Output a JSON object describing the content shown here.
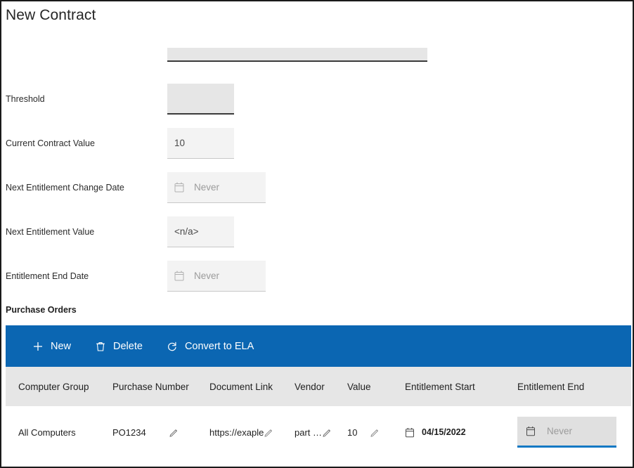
{
  "page": {
    "title": "New Contract"
  },
  "form": {
    "rows": [
      {
        "label": "",
        "value": "",
        "placeholder": "",
        "state": "editable",
        "size": "wide",
        "has_calendar": false
      },
      {
        "label": "Threshold",
        "value": "",
        "placeholder": "",
        "state": "editable",
        "size": "small",
        "has_calendar": false
      },
      {
        "label": "Current Contract Value",
        "value": "10",
        "placeholder": "",
        "state": "readonly",
        "size": "small",
        "has_calendar": false
      },
      {
        "label": "Next Entitlement Change Date",
        "value": "",
        "placeholder": "Never",
        "state": "readonly",
        "size": "date",
        "has_calendar": true
      },
      {
        "label": "Next Entitlement Value",
        "value": "<n/a>",
        "placeholder": "",
        "state": "readonly",
        "size": "small",
        "has_calendar": false
      },
      {
        "label": "Entitlement End Date",
        "value": "",
        "placeholder": "Never",
        "state": "readonly",
        "size": "date",
        "has_calendar": true
      }
    ]
  },
  "purchase_orders": {
    "section_title": "Purchase Orders",
    "toolbar": {
      "accent_color": "#0b66b2",
      "buttons": [
        {
          "label": "New",
          "icon": "plus-icon"
        },
        {
          "label": "Delete",
          "icon": "trash-icon"
        },
        {
          "label": "Convert to ELA",
          "icon": "refresh-icon"
        }
      ]
    },
    "columns": [
      "Computer Group",
      "Purchase Number",
      "Document Link",
      "Vendor",
      "Value",
      "Entitlement Start",
      "Entitlement End"
    ],
    "rows": [
      {
        "computer_group": "All Computers",
        "purchase_number": "PO1234",
        "document_link": "https://exaple",
        "vendor": "part …",
        "value": "10",
        "entitlement_start": "04/15/2022",
        "entitlement_end_placeholder": "Never",
        "entitlement_end_value": ""
      }
    ]
  }
}
